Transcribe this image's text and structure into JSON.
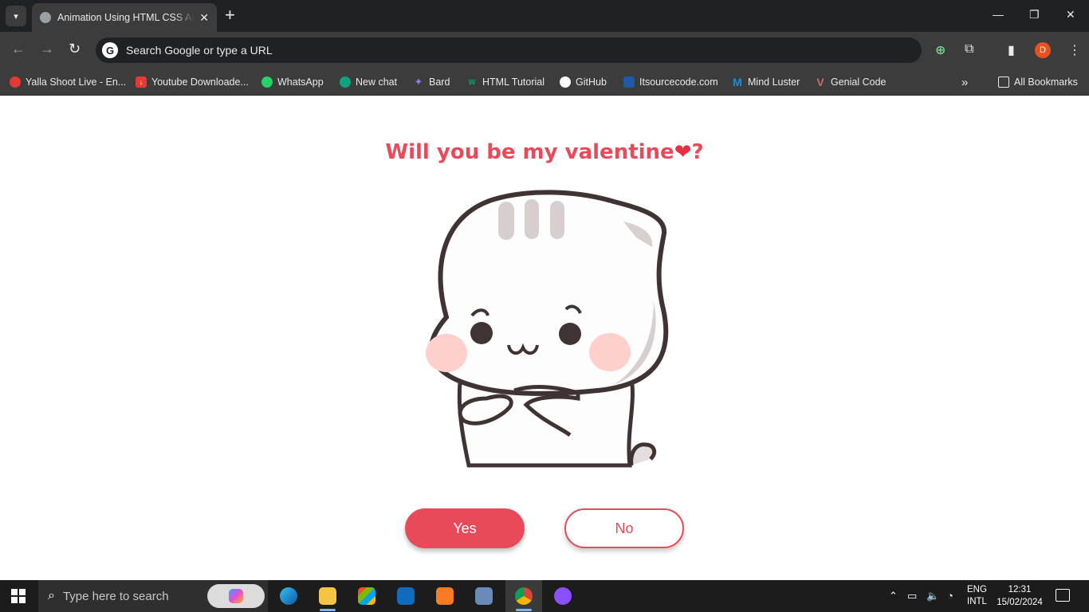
{
  "browser": {
    "tab_title": "Animation Using HTML CSS And JavaScript",
    "omnibox_placeholder": "Search Google or type a URL",
    "avatar_letter": "D",
    "bookmarks": [
      {
        "label": "Yalla Shoot Live - En...",
        "color": "#e53935"
      },
      {
        "label": "Youtube Downloade...",
        "color": "#e53935"
      },
      {
        "label": "WhatsApp",
        "color": "#25d366"
      },
      {
        "label": "New chat",
        "color": "#10a37f"
      },
      {
        "label": "Bard",
        "color": "#8e7cf0"
      },
      {
        "label": "HTML Tutorial",
        "color": "#04aa6d"
      },
      {
        "label": "GitHub",
        "color": "#ffffff"
      },
      {
        "label": "Itsourcecode.com",
        "color": "#1e5aa8"
      },
      {
        "label": "Mind Luster",
        "color": "#1a8fd6"
      },
      {
        "label": "Genial Code",
        "color": "#c96a6a"
      }
    ],
    "all_bookmarks_label": "All Bookmarks"
  },
  "page": {
    "question": "Will you be my valentine",
    "question_mark": "?",
    "heart_emoji": "❤",
    "yes_label": "Yes",
    "no_label": "No",
    "accent_color": "#e94a59"
  },
  "taskbar": {
    "search_placeholder": "Type here to search",
    "lang_line1": "ENG",
    "lang_line2": "INTL",
    "time": "12:31",
    "date": "15/02/2024"
  }
}
